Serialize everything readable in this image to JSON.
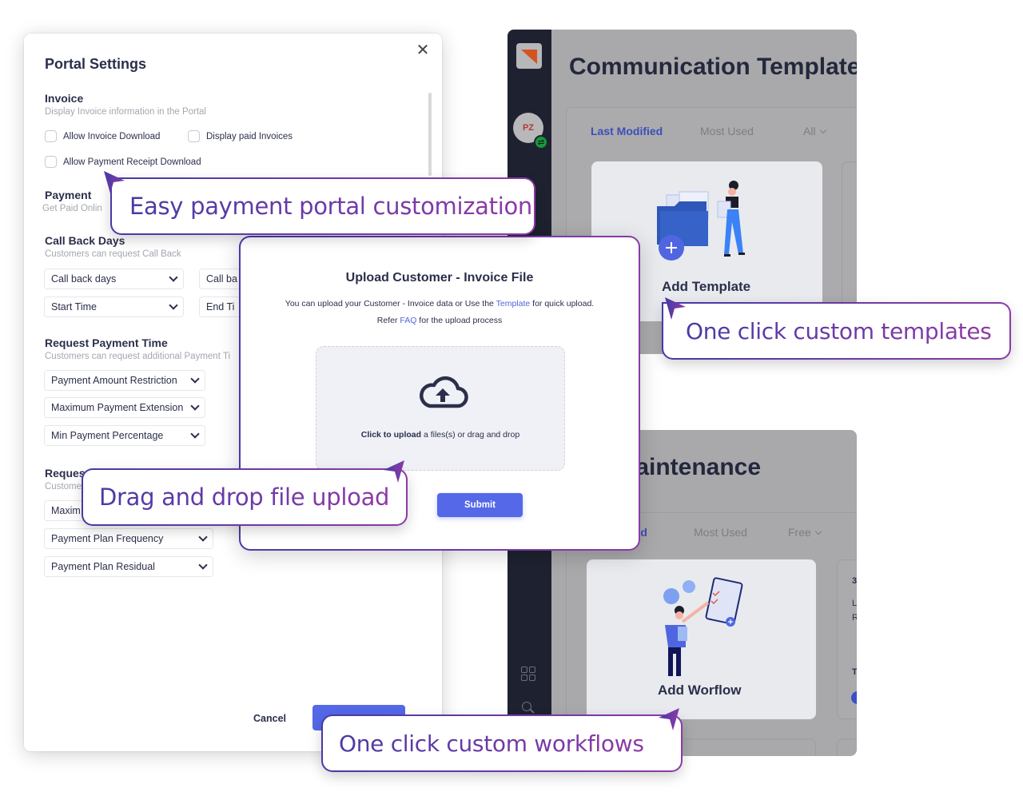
{
  "portal_settings": {
    "title": "Portal Settings",
    "close_icon": "close-icon",
    "invoice": {
      "title": "Invoice",
      "subtitle": "Display Invoice information in the Portal",
      "checkboxes": [
        {
          "label": "Allow Invoice Download",
          "checked": false
        },
        {
          "label": "Display paid Invoices",
          "checked": false
        },
        {
          "label": "Allow Payment Receipt Download",
          "checked": false
        }
      ]
    },
    "payment": {
      "title": "Payment",
      "subtitle": "Get Paid Onlin"
    },
    "call_back_days": {
      "title": "Call Back Days",
      "subtitle": "Customers can request Call Back",
      "selects": [
        "Call back days",
        "Call ba",
        "Start Time",
        "End Ti"
      ]
    },
    "request_payment_time": {
      "title": "Request Payment Time",
      "subtitle": "Customers can request additional Payment Ti",
      "selects": [
        "Payment Amount Restriction",
        "Maximum Payment Extension",
        "Min Payment Percentage"
      ]
    },
    "request_payment_plan": {
      "title": "Reques",
      "subtitle": "Custome",
      "selects": [
        "Maxim",
        "Payment Plan Frequency",
        "Payment Plan Residual"
      ]
    },
    "footer": {
      "cancel_label": "Cancel"
    }
  },
  "communication_template": {
    "title": "Communication Template",
    "avatar_initials": "PZ",
    "tabs": [
      {
        "label": "Last Modified",
        "active": true
      },
      {
        "label": "Most Used",
        "active": false
      },
      {
        "label": "All",
        "active": false,
        "dropdown": true
      }
    ],
    "add_card_label": "Add Template"
  },
  "workflow_maintenance": {
    "title": "low Maintenance",
    "tabs": [
      {
        "label": "fied",
        "active": true
      },
      {
        "label": "Most Used",
        "active": false
      },
      {
        "label": "Free",
        "active": false,
        "dropdown": true
      }
    ],
    "add_card_label": "Add Worflow",
    "side_card_fragments": [
      "3",
      "L",
      "R",
      "T"
    ]
  },
  "upload_modal": {
    "title": "Upload Customer - Invoice File",
    "desc_prefix": "You can upload your Customer - Invoice data or Use the ",
    "desc_link": "Template",
    "desc_suffix": " for quick upload.",
    "refer_prefix": "Refer ",
    "refer_link": "FAQ",
    "refer_suffix": " for the upload process",
    "dropzone_bold": "Click to upload",
    "dropzone_text": " a files(s) or drag and drop",
    "submit_label": "Submit"
  },
  "callouts": [
    {
      "text": "Easy payment portal customization"
    },
    {
      "text": "One click custom templates"
    },
    {
      "text": "Drag and drop file upload"
    },
    {
      "text": "One click custom workflows"
    }
  ],
  "colors": {
    "accent": "#5468e8",
    "callout_gradient_start": "#4a3aa6",
    "callout_gradient_end": "#8e3aa6",
    "sidebar": "#1e2230",
    "link": "#4f66e0"
  }
}
